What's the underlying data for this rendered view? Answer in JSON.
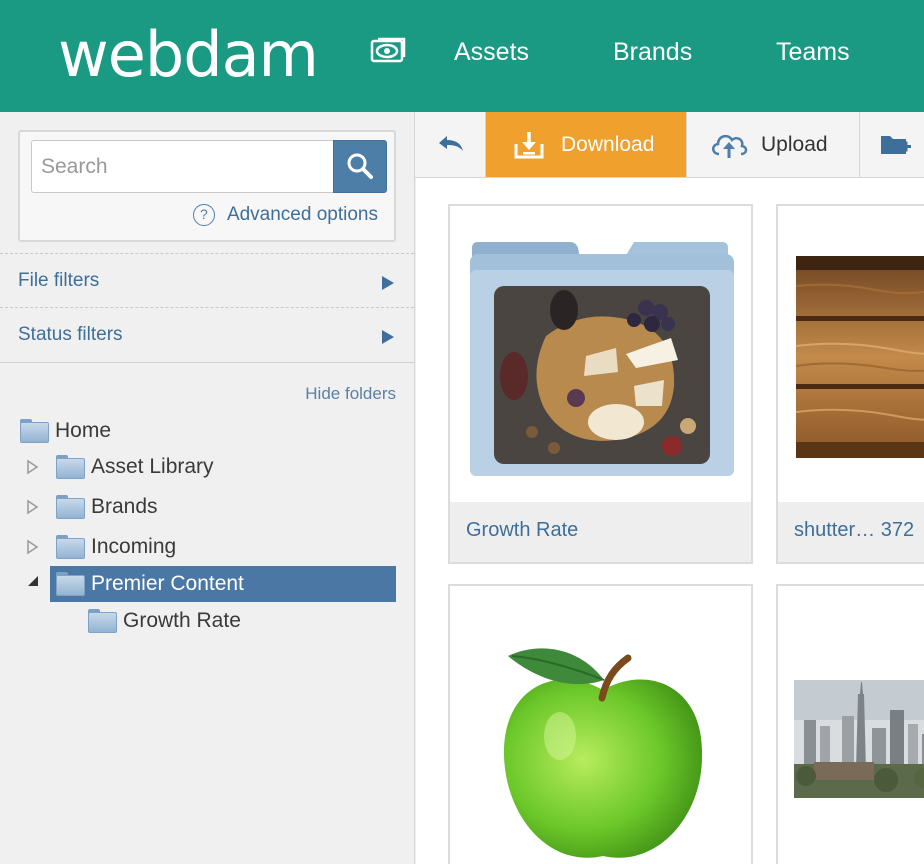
{
  "header": {
    "logo": "webdam",
    "nav": [
      "Assets",
      "Brands",
      "Teams"
    ],
    "icon": "eye-icon",
    "colors": {
      "background": "#1a9a82",
      "text": "#ffffff"
    }
  },
  "sidebar": {
    "search": {
      "placeholder": "Search",
      "value": "",
      "button_icon": "search-icon"
    },
    "advanced_options": "Advanced options",
    "filters": [
      {
        "label": "File filters"
      },
      {
        "label": "Status filters"
      }
    ],
    "hide_folders": "Hide folders",
    "tree": {
      "home": "Home",
      "items": [
        {
          "label": "Asset Library",
          "expanded": false
        },
        {
          "label": "Brands",
          "expanded": false
        },
        {
          "label": "Incoming",
          "expanded": false
        },
        {
          "label": "Premier Content",
          "expanded": true,
          "selected": true
        }
      ],
      "child": "Growth Rate"
    },
    "colors": {
      "selected_bg": "#4a77a4",
      "link": "#3d6f9a"
    }
  },
  "toolbar": {
    "back_icon": "back-arrow-icon",
    "download": {
      "label": "Download",
      "icon": "download-icon",
      "color": "#f0a02c"
    },
    "upload": {
      "label": "Upload",
      "icon": "cloud-upload-icon"
    },
    "new_folder_icon": "new-folder-icon"
  },
  "content": {
    "cards": [
      {
        "caption": "Growth Rate",
        "kind": "folder",
        "thumbnail": "cheese-board-image"
      },
      {
        "caption": "shutter…  372",
        "kind": "image",
        "thumbnail": "wood-planks-image"
      },
      {
        "caption": "",
        "kind": "image",
        "thumbnail": "green-apple-image"
      },
      {
        "caption": "",
        "kind": "image",
        "thumbnail": "city-skyline-image"
      }
    ]
  }
}
